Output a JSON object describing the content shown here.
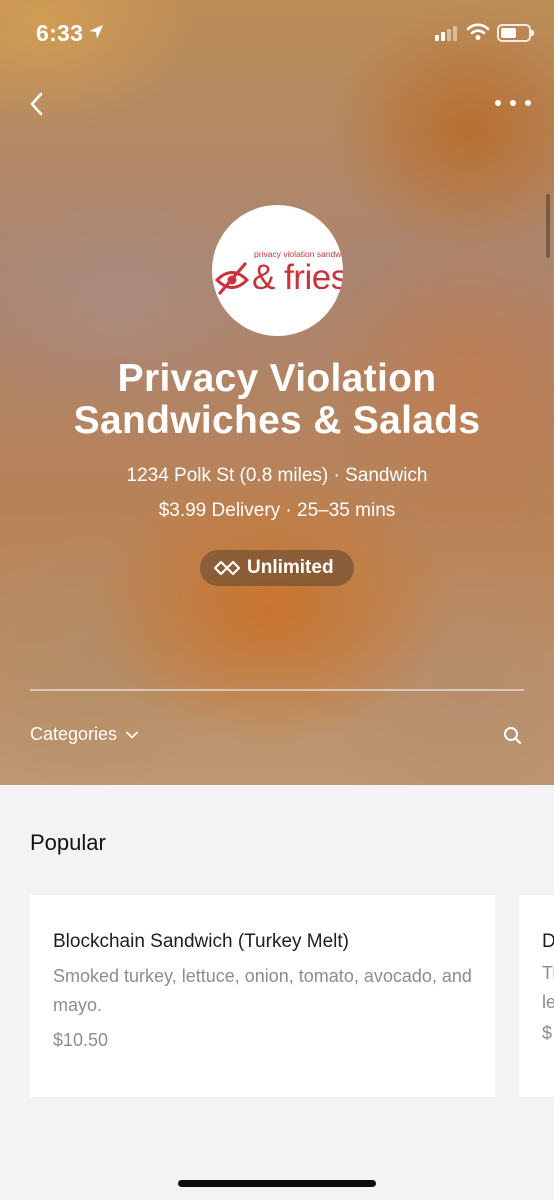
{
  "status_bar": {
    "time": "6:33"
  },
  "store": {
    "logo": {
      "small_text": "privacy violation sandwiches",
      "main_text": "& fries"
    },
    "name": "Privacy Violation Sandwiches & Salads",
    "address_line": "1234 Polk St (0.8 miles) · Sandwich",
    "delivery_line": "$3.99 Delivery · 25–35 mins",
    "badge": "Unlimited"
  },
  "toolbar": {
    "categories_label": "Categories"
  },
  "popular": {
    "title": "Popular",
    "items": [
      {
        "name": "Blockchain Sandwich (Turkey Melt)",
        "description": "Smoked turkey, lettuce, onion, tomato, avocado, and mayo.",
        "price": "$10.50"
      },
      {
        "name": "D S",
        "description": "Tu le",
        "price": "$"
      }
    ]
  },
  "colors": {
    "brand_red": "#c8343c",
    "card_bg": "#ffffff",
    "page_bg": "#f3f3f6"
  }
}
